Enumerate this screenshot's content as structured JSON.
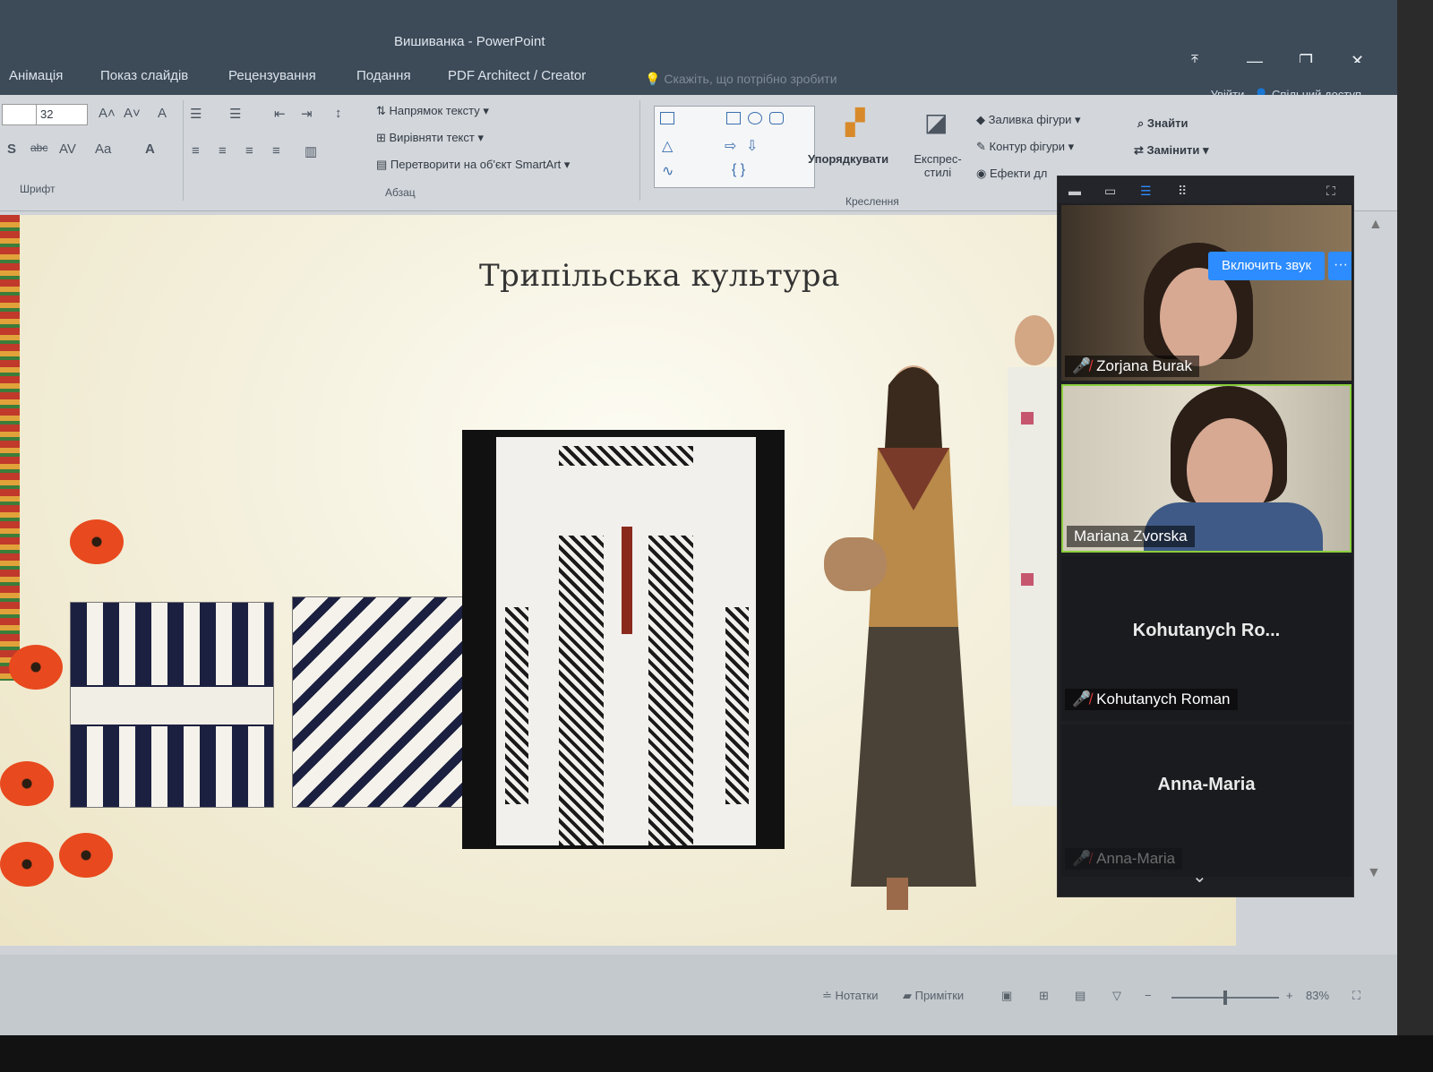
{
  "window": {
    "title": "Вишиванка - PowerPoint"
  },
  "ribbon_tabs": [
    "Анімація",
    "Показ слайдів",
    "Рецензування",
    "Подання",
    "PDF Architect / Creator"
  ],
  "tell_me_placeholder": "Скажіть, що потрібно зробити",
  "account": {
    "sign_in": "Увійти",
    "share": "Спільний доступ"
  },
  "ribbon": {
    "font_size": "32",
    "font_group_label": "Шрифт",
    "paragraph_group_label": "Абзац",
    "drawing_group_label": "Креслення",
    "text_direction": "Напрямок тексту",
    "align_text": "Вирівняти текст",
    "convert_smartart": "Перетворити на об'єкт SmartArt",
    "arrange": "Упорядкувати",
    "quick_styles": "Експрес-стилі",
    "shape_fill": "Заливка фігури",
    "shape_outline": "Контур фігури",
    "shape_effects": "Ефекти дл",
    "find": "Знайти",
    "replace": "Замінити"
  },
  "slide": {
    "title": "Трипільська культура"
  },
  "video_panel": {
    "unmute_label": "Включить звук",
    "more_label": "···",
    "participants": [
      {
        "name": "Zorjana Burak",
        "muted": true,
        "video": true
      },
      {
        "name": "Mariana Zvorska",
        "muted": false,
        "video": true
      },
      {
        "name": "Kohutanych  Ro...",
        "sub_name": "Kohutanych Roman",
        "muted": true,
        "video": false
      },
      {
        "name": "Anna-Maria",
        "sub_name": "Anna-Maria",
        "muted": true,
        "video": false
      }
    ]
  },
  "statusbar": {
    "notes": "Нотатки",
    "comments": "Примітки",
    "zoom": "83%"
  },
  "colors": {
    "zoom_blue": "#2d8cff",
    "active_speaker_border": "#8bcf3c",
    "mic_muted": "#e53935"
  }
}
